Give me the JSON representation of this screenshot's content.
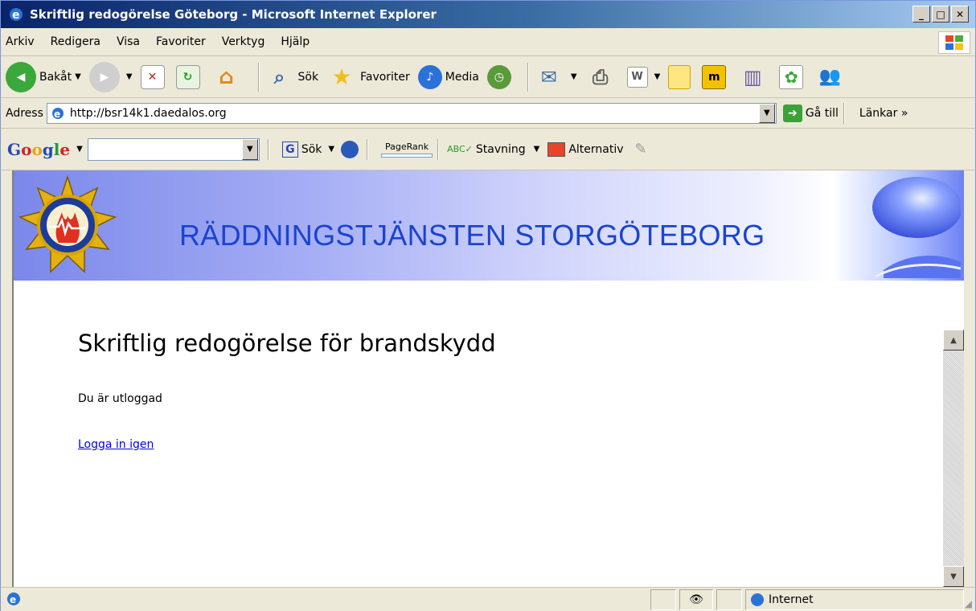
{
  "window": {
    "title": "Skriftlig redogörelse Göteborg - Microsoft Internet Explorer"
  },
  "menubar": {
    "items": [
      {
        "label": "Arkiv"
      },
      {
        "label": "Redigera"
      },
      {
        "label": "Visa"
      },
      {
        "label": "Favoriter"
      },
      {
        "label": "Verktyg"
      },
      {
        "label": "Hjälp"
      }
    ]
  },
  "toolbar": {
    "back_label": "Bakåt",
    "search_label": "Sök",
    "favorites_label": "Favoriter",
    "media_label": "Media"
  },
  "address": {
    "label": "Adress",
    "url": "http://bsr14k1.daedalos.org",
    "go_label": "Gå till",
    "links_label": "Länkar"
  },
  "googlebar": {
    "search_label": "Sök",
    "pagerank_label": "PageRank",
    "spelling_label": "Stavning",
    "options_label": "Alternativ"
  },
  "page": {
    "banner_title": "RÄDDNINGSTJÄNSTEN STORGÖTEBORG",
    "heading": "Skriftlig redogörelse för brandskydd",
    "status_text": "Du är utloggad",
    "relogin_link": "Logga in igen"
  },
  "statusbar": {
    "zone": "Internet"
  },
  "colors": {
    "banner_text": "#1a44cf",
    "link": "#0000ee",
    "titlebar": "#0a246a"
  }
}
